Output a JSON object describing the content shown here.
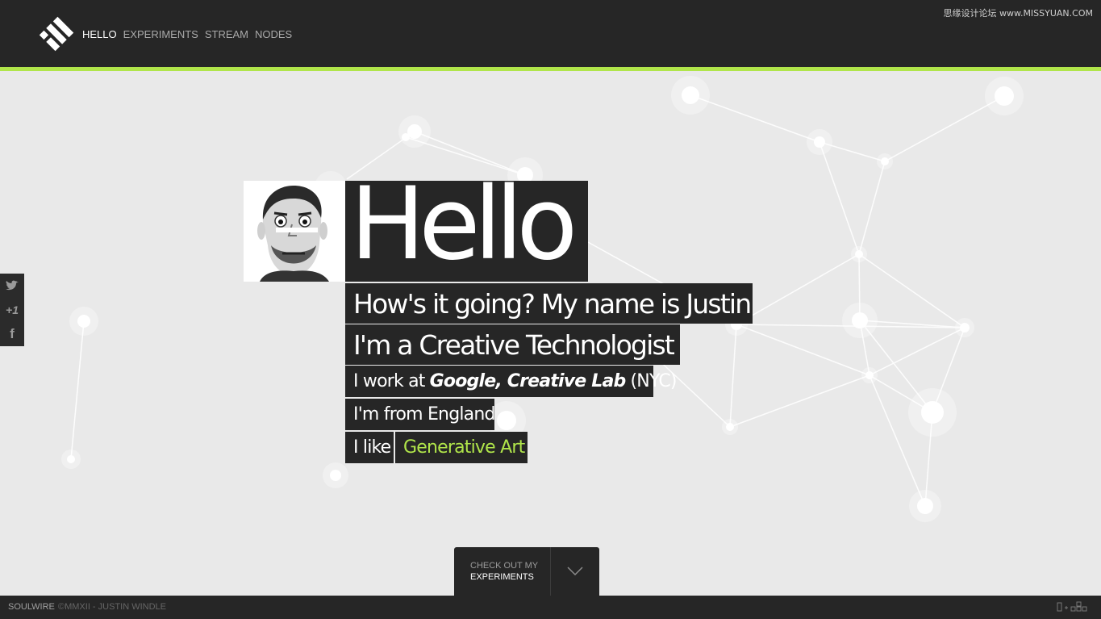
{
  "colors": {
    "accent": "#b0e54a",
    "bar": "#262626",
    "page_bg": "#e9e9e9"
  },
  "header": {
    "logo_icon": "soulwire-logo-icon",
    "nav": [
      {
        "label": "HELLO",
        "active": true
      },
      {
        "label": "EXPERIMENTS",
        "active": false
      },
      {
        "label": "STREAM",
        "active": false
      },
      {
        "label": "NODES",
        "active": false
      }
    ],
    "watermark": "思缘设计论坛 www.MISSYUAN.COM"
  },
  "social": [
    {
      "icon": "twitter-icon"
    },
    {
      "icon": "plus-one-icon",
      "label": "+1"
    },
    {
      "icon": "facebook-icon",
      "label": "f"
    }
  ],
  "intro": {
    "avatar_icon": "avatar",
    "hello": "Hello",
    "line1": "How's it going? My name is Justin",
    "line2": "I'm a Creative Technologist",
    "line3_prefix": "I work at",
    "line3_company": "Google, Creative Lab",
    "line3_suffix": "(NYC)",
    "line4": "I'm from England",
    "like_label": "I like",
    "like_value": "Generative Art"
  },
  "cta": {
    "line1": "CHECK OUT MY",
    "line2": "EXPERIMENTS",
    "icon": "chevron-down-icon"
  },
  "footer": {
    "brand": "SOULWIRE",
    "copyright": "©MMXII - JUSTIN WINDLE",
    "tools_icon": "view-toggle-icon"
  }
}
